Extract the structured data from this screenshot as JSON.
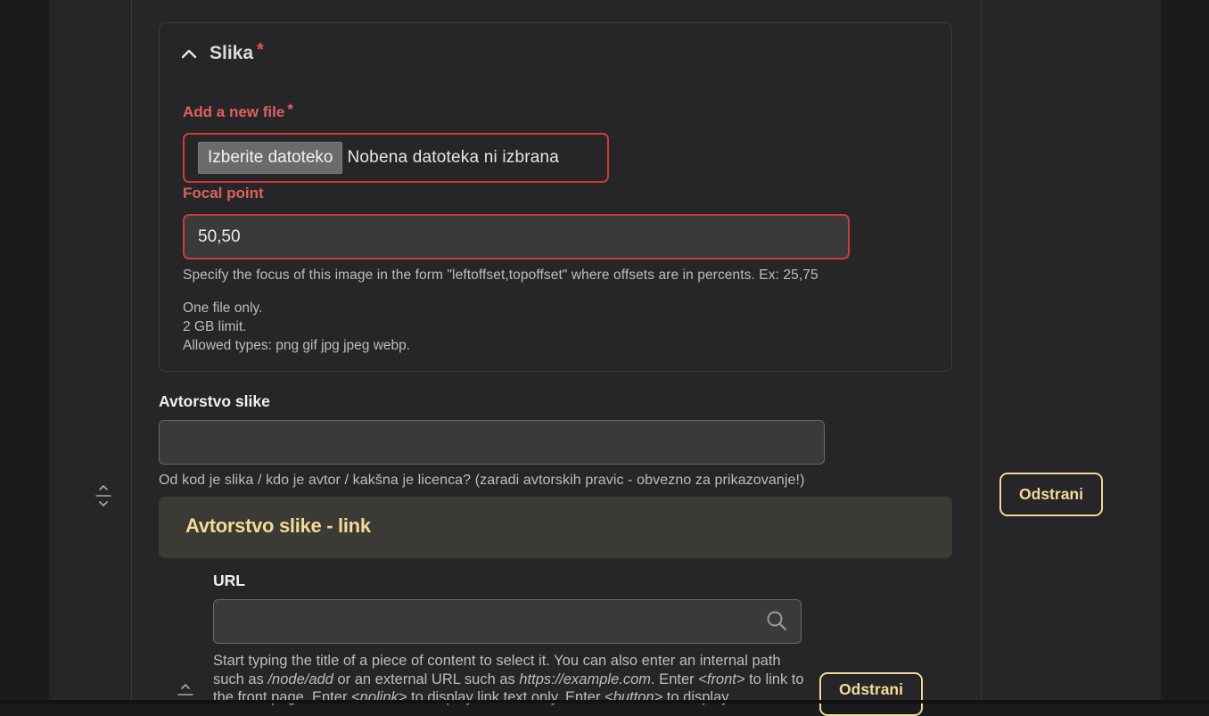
{
  "slika": {
    "title": "Slika",
    "required_mark": "*",
    "add_file_label": "Add a new file",
    "add_file_required": "*",
    "choose_button": "Izberite datoteko",
    "no_file_text": "Nobena datoteka ni izbrana",
    "focal_label": "Focal point",
    "focal_value": "50,50",
    "focal_help": "Specify the focus of this image in the form \"leftoffset,topoffset\" where offsets are in percents. Ex: 25,75",
    "limits": [
      "One file only.",
      "2 GB limit.",
      "Allowed types: png gif jpg jpeg webp."
    ]
  },
  "avtorstvo": {
    "label": "Avtorstvo slike",
    "value": "",
    "help": "Od kod je slika / kdo je avtor / kakšna je licenca? (zaradi avtorskih pravic - obvezno za prikazovanje!)"
  },
  "link_card": {
    "title": "Avtorstvo slike - link",
    "url_label": "URL",
    "url_value": "",
    "url_help_parts": [
      "Start typing the title of a piece of content to select it. You can also enter an internal path such as ",
      "/node/add",
      " or an external URL such as ",
      "https://example.com",
      ". Enter ",
      "<front>",
      " to link to the front page. Enter ",
      "<nolink>",
      " to display link text only. Enter ",
      "<button>",
      " to display"
    ]
  },
  "buttons": {
    "remove_main": "Odstrani",
    "remove_link": "Odstrani"
  },
  "colors": {
    "accent": "#f3d99a",
    "error": "#d03a3a",
    "background": "#262628"
  },
  "icons": {
    "collapse": "chevron-up-icon",
    "search": "search-icon",
    "drag": "drag-handle-icon"
  }
}
